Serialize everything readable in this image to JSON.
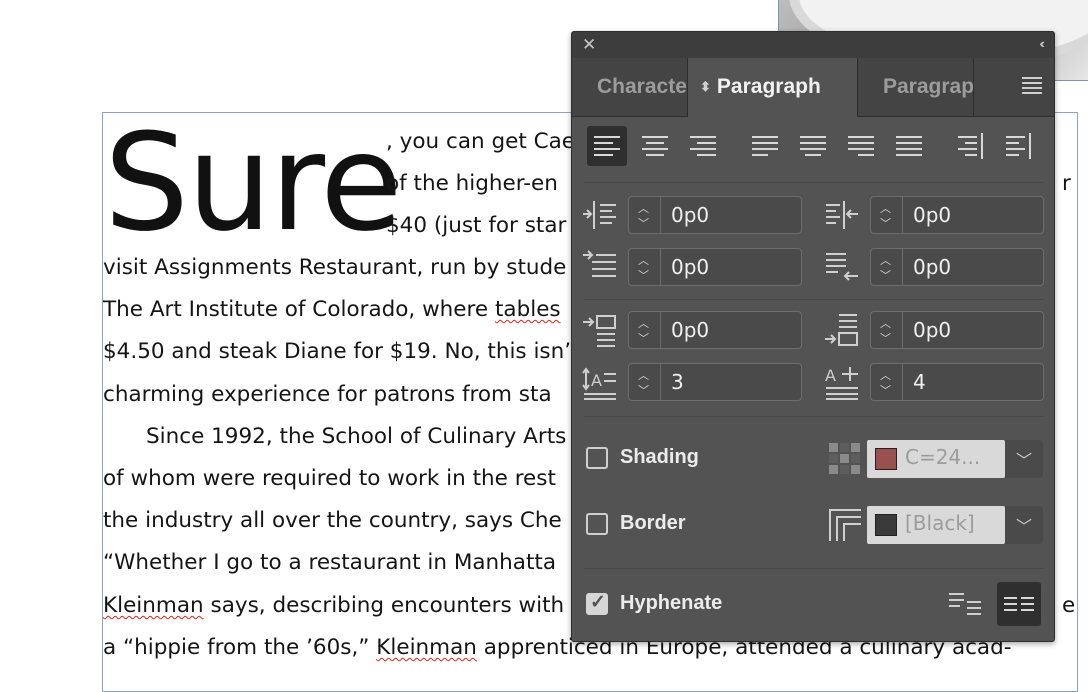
{
  "document": {
    "drop_cap": "Sure",
    "lines": [
      ", you can get Cae",
      "of the higher-en",
      "$40 (just for star",
      "visit Assignments Restaurant, run by stude",
      "The Art Institute of Colorado, where ",
      "$4.50 and steak Diane for $19. No, this isn’",
      "charming experience for patrons from sta",
      "Since 1992, the School of Culinary Arts",
      "of whom were required to work in the rest",
      "the industry all over the country, says Che",
      "“Whether I go to a restaurant in Manhatta",
      " says, describing encounters with",
      "a “hippie from the ’60s,” ",
      " apprenticed in Europe, attended a culinary acad-"
    ],
    "squiggle_words": {
      "tables": "tables",
      "kleinman": "Kleinman",
      "sixties": "’60s"
    },
    "edge_fragments": {
      "line2": "r",
      "line12": "e"
    }
  },
  "panel": {
    "tabs": [
      {
        "label": "Characte",
        "active": false
      },
      {
        "label": "Paragraph",
        "active": true
      },
      {
        "label": "Paragrap",
        "active": false
      }
    ],
    "alignment_buttons": [
      "align-left",
      "align-center",
      "align-right",
      "justify-left",
      "justify-center",
      "justify-right",
      "justify-all",
      "align-towards-spine",
      "align-away-from-spine"
    ],
    "selected_alignment": "align-left",
    "fields": {
      "left_indent": "0p0",
      "right_indent": "0p0",
      "first_line_indent": "0p0",
      "last_line_right_indent": "0p0",
      "space_before": "0p0",
      "space_after": "0p0",
      "drop_cap_lines": "3",
      "drop_cap_characters": "4"
    },
    "shading": {
      "label": "Shading",
      "checked": false,
      "swatch_label": "C=24...",
      "swatch_color": "#9a5050"
    },
    "border": {
      "label": "Border",
      "checked": false,
      "swatch_label": "[Black]",
      "swatch_color": "#3a3a3a"
    },
    "hyphenate": {
      "label": "Hyphenate",
      "checked": true
    }
  }
}
